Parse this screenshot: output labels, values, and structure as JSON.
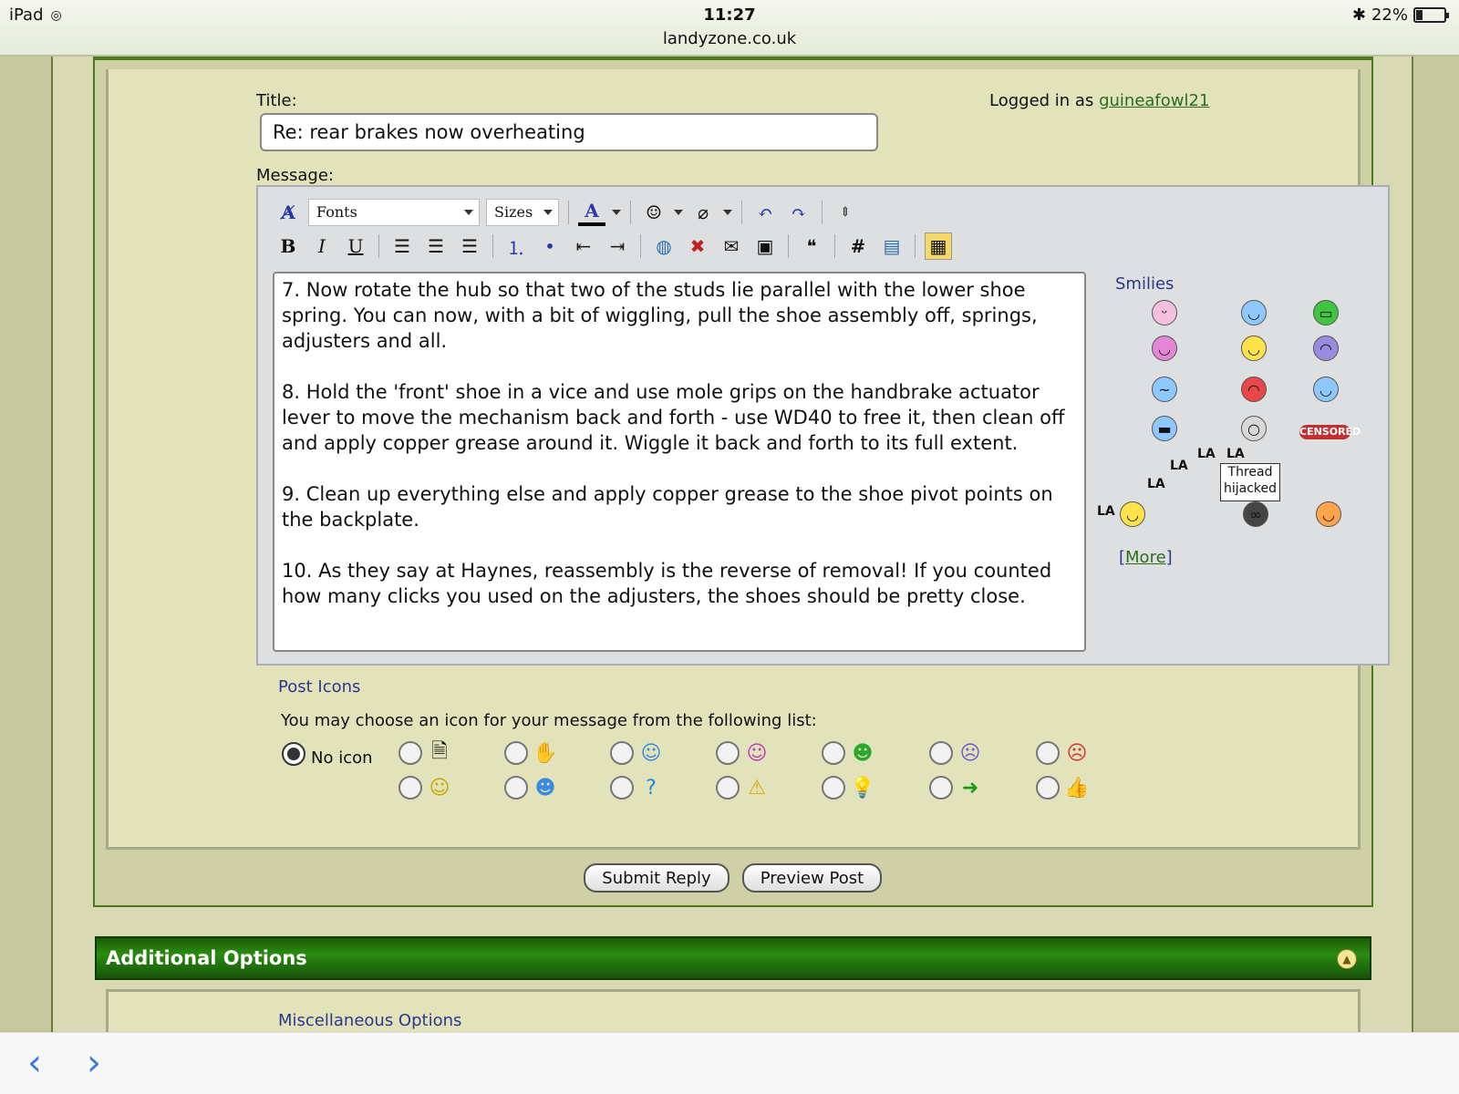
{
  "status_bar": {
    "device": "iPad",
    "time": "11:27",
    "url": "landyzone.co.uk",
    "battery": "22%",
    "battery_level": 0.22
  },
  "form": {
    "title_label": "Title:",
    "title_value": "Re: rear brakes now overheating",
    "logged_in_prefix": "Logged in as",
    "username": "guineafowl21",
    "message_label": "Message:"
  },
  "toolbar": {
    "fonts_label": "Fonts",
    "sizes_label": "Sizes",
    "bold": "B",
    "italic": "I",
    "underline": "U",
    "hash": "#"
  },
  "message": {
    "text": "7. Now rotate the hub so that two of the studs lie parallel with the lower shoe spring. You can now, with a bit of wiggling, pull the shoe assembly off, springs, adjusters and all.\n\n8. Hold the 'front' shoe in a vice and use mole grips on the handbrake actuator lever to move the mechanism back and forth - use WD40 to free it, then clean off and apply copper grease around it. Wiggle it back and forth to its full extent.\n\n9. Clean up everything else and apply copper grease to the shoe pivot points on the backplate.\n\n10. As they say at Haynes, reassembly is the reverse of removal! If you counted how many clicks you used on the adjusters, the shoes should be pretty close."
  },
  "smilies": {
    "title": "Smilies",
    "more_label": "More",
    "more_open": "[",
    "more_close": "]",
    "sign_line1": "Thread",
    "sign_line2": "hijacked",
    "censored": "CENSORED",
    "la": "LA"
  },
  "post_icons": {
    "title": "Post Icons",
    "description": "You may choose an icon for your message from the following list:",
    "no_icon_label": "No icon",
    "selected": "No icon"
  },
  "buttons": {
    "submit": "Submit Reply",
    "preview": "Preview Post"
  },
  "additional_options": {
    "title": "Additional Options",
    "misc_title": "Miscellaneous Options"
  },
  "bottom_nav": {
    "back": "‹",
    "forward": "›"
  }
}
